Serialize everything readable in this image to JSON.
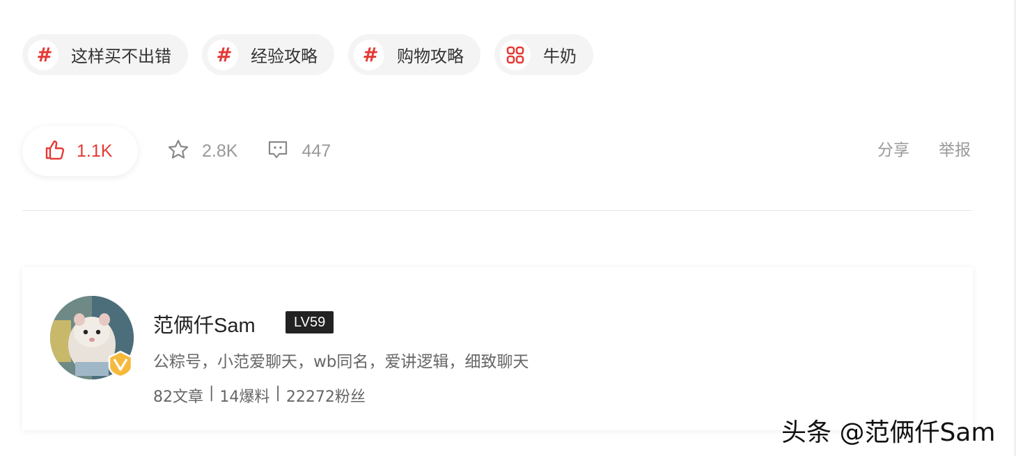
{
  "tags": [
    {
      "label": "这样买不出错",
      "icon": "hashtag-icon"
    },
    {
      "label": "经验攻略",
      "icon": "hashtag-icon"
    },
    {
      "label": "购物攻略",
      "icon": "hashtag-icon"
    },
    {
      "label": "牛奶",
      "icon": "category-grid-icon"
    }
  ],
  "actions": {
    "like_count": "1.1K",
    "favorite_count": "2.8K",
    "comment_count": "447",
    "share_label": "分享",
    "report_label": "举报"
  },
  "author": {
    "name": "范俩仟Sam",
    "level": "LV59",
    "bio": "公粽号，小范爱聊天，wb同名，爱讲逻辑，细致聊天",
    "stats": {
      "articles": "82文章",
      "sep": "|",
      "deals": "14爆料",
      "followers": "22272粉丝"
    }
  },
  "watermark": "头条 @范俩仟Sam",
  "colors": {
    "accent": "#e53935",
    "tag_bg": "#f4f4f4",
    "badge_gold": "#f5b93c"
  }
}
